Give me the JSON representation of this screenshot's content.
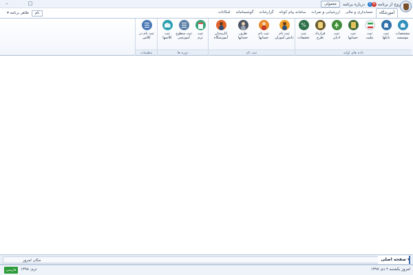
{
  "window": {
    "minimize_label": "–",
    "maximize_label": "□"
  },
  "quick_access": {
    "exit_label": "خروج از برنامه",
    "about_label": "درباره برنامه",
    "theme_label": "معمولی",
    "exit_color": "#d33a2c",
    "about_color": "#2f7fd1"
  },
  "left_toolbar": {
    "appearance_label": "ظاهر برنامه",
    "field_value": "نام"
  },
  "tabs": [
    {
      "label": "آموزشگاه",
      "active": true
    },
    {
      "label": "حسابداری و مالی"
    },
    {
      "label": "ارزشیابی و نمرات"
    },
    {
      "label": "سامانه پیام کوتاه"
    },
    {
      "label": "گزارشات"
    },
    {
      "label": "گوشسامانه"
    },
    {
      "label": "امکانات"
    }
  ],
  "ribbon": {
    "groups": [
      {
        "caption": "داده های اولیه",
        "buttons": [
          {
            "label": "مشخصات\nموسسه",
            "icon": "building-icon"
          },
          {
            "label": "ثبت\nبانکها",
            "icon": "bank-icon"
          },
          {
            "label": "ثبت\nملیت",
            "icon": "flag-icon"
          },
          {
            "label": "ثبت\nحسابها",
            "icon": "ledger-icon"
          },
          {
            "label": "ثبت\nادیان",
            "icon": "tree-icon"
          },
          {
            "label": "قرارداد\nطرح",
            "icon": "train-icon"
          },
          {
            "label": "ثبت\nتخفیفات",
            "icon": "percent-icon"
          }
        ]
      },
      {
        "caption": "ثبت نام",
        "buttons": [
          {
            "label": "ثبت نام\nدانش آموزان",
            "icon": "student-icon"
          },
          {
            "label": "ثبت نام\nحسابها",
            "icon": "user-icon"
          },
          {
            "label": "طرف\nحسابها",
            "icon": "contact-icon"
          },
          {
            "label": "کارمندان\nآموزشگاه",
            "icon": "staff-icon"
          }
        ]
      },
      {
        "caption": "دوره ها",
        "buttons": [
          {
            "label": "ثبت\nترم",
            "icon": "calendar-icon"
          },
          {
            "label": "ثبت سطوح\nآموزشی",
            "icon": "list-icon"
          },
          {
            "label": "ثبت\nکلاسها",
            "icon": "classroom-icon"
          }
        ]
      },
      {
        "caption": "تنظیمات",
        "buttons": [
          {
            "label": "ثبت نام در\nکلاس",
            "icon": "menu-icon"
          }
        ]
      }
    ]
  },
  "bottom_strip": {
    "home_tab_label": "صفحه اصلی",
    "ticker_text": "مکان امروز"
  },
  "status": {
    "date_text": "امروز یکشنبه ۲ دی ۱۳۹۷",
    "term_text": "ترم: ۱۳۹۸",
    "language_label": "فارسی",
    "language_color": "#2e9b3a"
  }
}
